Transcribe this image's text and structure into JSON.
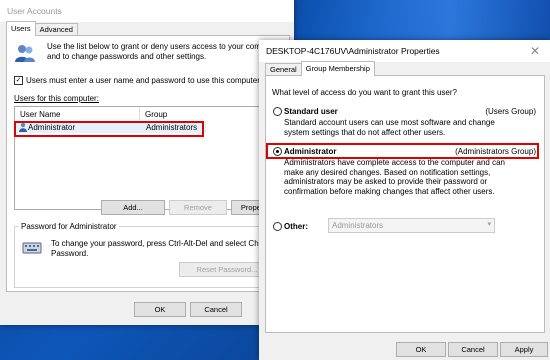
{
  "ua": {
    "title": "User Accounts",
    "tabs": [
      "Users",
      "Advanced"
    ],
    "intro": "Use the list below to grant or deny users access to your computer, and to change passwords and other settings.",
    "must_enter_label": "Users must enter a user name and password to use this computer.",
    "users_label": "Users for this computer:",
    "columns": [
      "User Name",
      "Group"
    ],
    "rows": [
      {
        "name": "Administrator",
        "group": "Administrators"
      }
    ],
    "add_label": "Add...",
    "remove_label": "Remove",
    "properties_label": "Properties",
    "password_group_label": "Password for Administrator",
    "password_text": "To change your password, press Ctrl-Alt-Del and select Change Password.",
    "reset_label": "Reset Password...",
    "ok_label": "OK",
    "cancel_label": "Cancel"
  },
  "props": {
    "title": "DESKTOP-4C176UV\\Administrator Properties",
    "tabs": [
      "General",
      "Group Membership"
    ],
    "question": "What level of access do you want to grant this user?",
    "options": [
      {
        "label": "Standard user",
        "group": "(Users Group)",
        "desc": "Standard account users can use most software and change system settings that do not affect other users."
      },
      {
        "label": "Administrator",
        "group": "(Administrators Group)",
        "desc": "Administrators have complete access to the computer and can make any desired changes. Based on notification settings, administrators may be asked to provide their password or confirmation before making changes that affect other users."
      },
      {
        "label": "Other:",
        "select_value": "Administrators"
      }
    ],
    "ok_label": "OK",
    "cancel_label": "Cancel",
    "apply_label": "Apply"
  },
  "accent": "#e00000"
}
